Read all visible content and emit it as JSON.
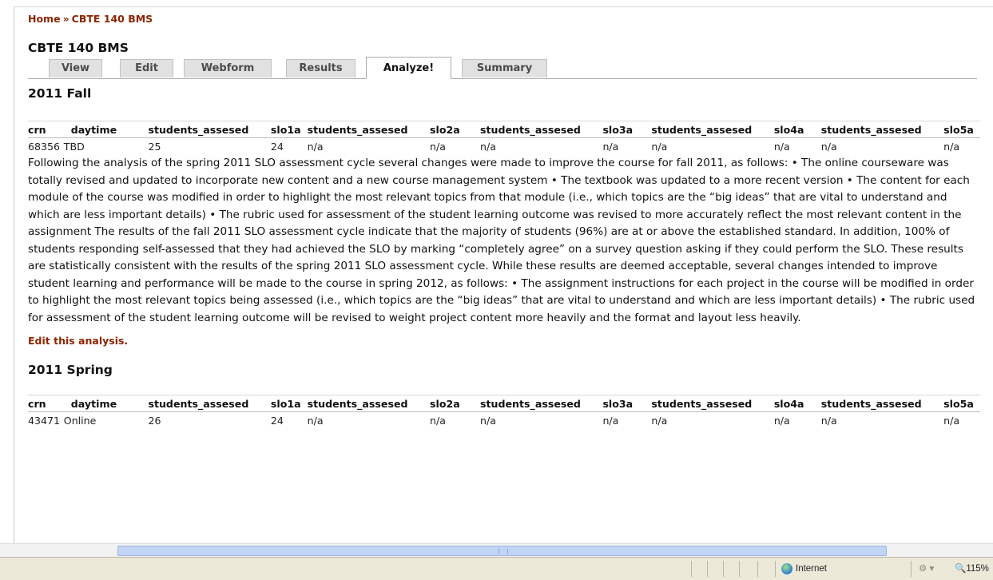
{
  "breadcrumb": {
    "home": "Home",
    "separator": "»",
    "current": "CBTE 140 BMS"
  },
  "page_title": "CBTE 140 BMS",
  "tabs": [
    "View",
    "Edit",
    "Webform",
    "Results",
    "Analyze!",
    "Summary"
  ],
  "active_tab": "Analyze!",
  "table_headers": [
    "crn",
    "daytime",
    "students_assesed",
    "slo1a",
    "students_assesed",
    "slo2a",
    "students_assesed",
    "slo3a",
    "students_assesed",
    "slo4a",
    "students_assesed",
    "slo5a"
  ],
  "fall": {
    "title": "2011 Fall",
    "row": [
      "68356",
      "TBD",
      "25",
      "24",
      "n/a",
      "n/a",
      "n/a",
      "n/a",
      "n/a",
      "n/a",
      "n/a",
      "n/a"
    ],
    "analysis": "Following the analysis of the spring 2011 SLO assessment cycle several changes were made to improve the course for fall 2011, as follows: • The online courseware was totally revised and updated to incorporate new content and a new course management system • The textbook was updated to a more recent version • The content for each module of the course was modified in order to highlight the most relevant topics from that module (i.e., which topics are the “big ideas” that are vital to understand and which are less important details) • The rubric used for assessment of the student learning outcome was revised to more accurately reflect the most relevant content in the assignment The results of the fall 2011 SLO assessment cycle indicate that the majority of students (96%) are at or above the established standard. In addition, 100% of students responding self-assessed that they had achieved the SLO by marking “completely agree” on a survey question asking if they could perform the SLO. These results are statistically consistent with the results of the spring 2011 SLO assessment cycle. While these results are deemed acceptable, several changes intended to improve student learning and performance will be made to the course in spring 2012, as follows: • The assignment instructions for each project in the course will be modified in order to highlight the most relevant topics being assessed (i.e., which topics are the “big ideas” that are vital to understand and which are less important details) • The rubric used for assessment of the student learning outcome will be revised to weight project content more heavily and the format and layout less heavily.",
    "edit_link": "Edit this analysis."
  },
  "spring": {
    "title": "2011 Spring",
    "row": [
      "43471",
      "Online",
      "26",
      "24",
      "n/a",
      "n/a",
      "n/a",
      "n/a",
      "n/a",
      "n/a",
      "n/a",
      "n/a"
    ]
  },
  "statusbar": {
    "zone": "Internet",
    "zoom": "115%"
  },
  "colors": {
    "link": "#8b2500",
    "tab_bg": "#e1e1e1",
    "scroll_thumb": "#c3d5f5",
    "statusbar": "#ece9d8"
  }
}
